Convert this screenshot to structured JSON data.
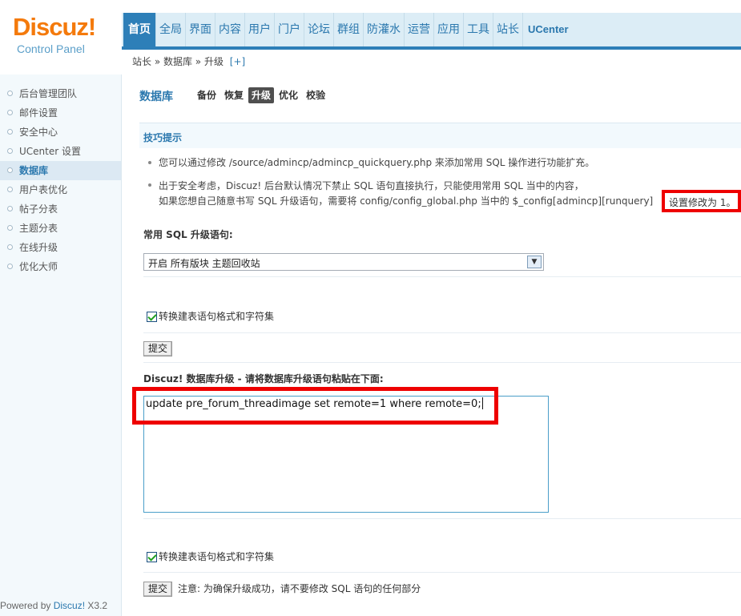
{
  "logo": {
    "brand": "Discuz!",
    "subtitle": "Control Panel"
  },
  "nav": [
    "首页",
    "全局",
    "界面",
    "内容",
    "用户",
    "门户",
    "论坛",
    "群组",
    "防灌水",
    "运营",
    "应用",
    "工具",
    "站长",
    "UCenter"
  ],
  "breadcrumb": {
    "text": "站长 » 数据库 » 升级",
    "plus": "[+]"
  },
  "sidebar": {
    "items": [
      "后台管理团队",
      "邮件设置",
      "安全中心",
      "UCenter 设置",
      "数据库",
      "用户表优化",
      "帖子分表",
      "主题分表",
      "在线升级",
      "优化大师"
    ],
    "active_index": 4
  },
  "powered": {
    "prefix": "Powered by",
    "brand": "Discuz!",
    "version": "X3.2"
  },
  "main": {
    "title": "数据库",
    "subtabs": [
      "备份",
      "恢复",
      "升级",
      "优化",
      "校验"
    ],
    "tips_title": "技巧提示",
    "tip1": "您可以通过修改 /source/admincp/admincp_quickquery.php 来添加常用 SQL 操作进行功能扩充。",
    "tip2_line1": "出于安全考虑，Discuz! 后台默认情况下禁止 SQL 语句直接执行，只能使用常用 SQL 当中的内容，",
    "tip2_line2": "如果您想自己随意书写 SQL 升级语句，需要将 config/config_global.php 当中的 $_config[admincp][runquery]",
    "tip2_highlight": "设置修改为 1。",
    "common_sql_label": "常用 SQL 升级语句:",
    "common_sql_selected": "开启 所有版块 主题回收站",
    "checkbox1_label": "转换建表语句格式和字符集",
    "submit1": "提交",
    "upgrade_label": "Discuz! 数据库升级 - 请将数据库升级语句粘贴在下面:",
    "sql_text": "update pre_forum_threadimage set remote=1 where remote=0;",
    "checkbox2_label": "转换建表语句格式和字符集",
    "submit2": "提交",
    "note": "注意: 为确保升级成功，请不要修改 SQL 语句的任何部分"
  }
}
